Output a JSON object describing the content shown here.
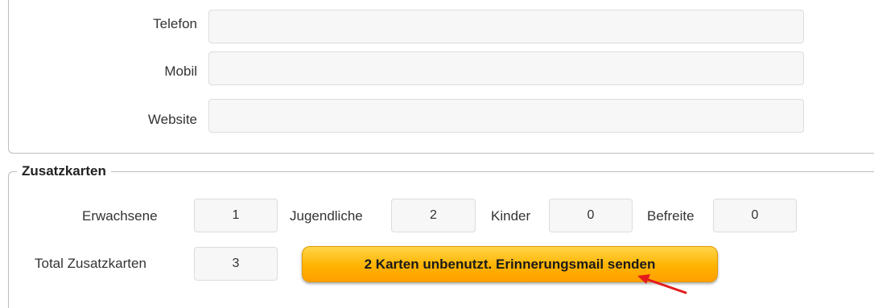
{
  "contact": {
    "phone_label": "Telefon",
    "phone_value": "",
    "mobile_label": "Mobil",
    "mobile_value": "",
    "website_label": "Website",
    "website_value": ""
  },
  "extra_cards": {
    "legend": "Zusatzkarten",
    "adults_label": "Erwachsene",
    "adults_value": "1",
    "youth_label": "Jugendliche",
    "youth_value": "2",
    "children_label": "Kinder",
    "children_value": "0",
    "exempt_label": "Befreite",
    "exempt_value": "0",
    "total_label": "Total Zusatzkarten",
    "total_value": "3",
    "reminder_button": "2 Karten unbenutzt. Erinnerungsmail senden"
  },
  "colors": {
    "button": "#ffb300",
    "arrow": "#e31b1b"
  }
}
